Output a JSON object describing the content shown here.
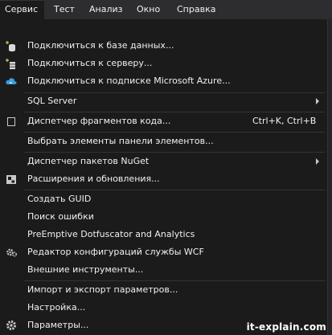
{
  "menubar": {
    "items": [
      {
        "label": "Сервис"
      },
      {
        "label": "Тест"
      },
      {
        "label": "Анализ"
      },
      {
        "label": "Окно"
      },
      {
        "label": "Справка"
      }
    ]
  },
  "menu": {
    "items": [
      {
        "label": "Подключиться к базе данных...",
        "icon": "connect-database-icon"
      },
      {
        "label": "Подключиться к серверу...",
        "icon": "connect-server-icon"
      },
      {
        "label": "Подключиться к подписке Microsoft Azure...",
        "icon": "azure-cloud-icon"
      },
      {
        "label": "SQL Server",
        "submenu": true
      },
      {
        "label": "Диспетчер фрагментов кода...",
        "shortcut": "Ctrl+K, Ctrl+B",
        "icon": "checkbox-icon"
      },
      {
        "label": "Выбрать элементы панели элементов..."
      },
      {
        "label": "Диспетчер пакетов NuGet",
        "submenu": true
      },
      {
        "label": "Расширения и обновления...",
        "icon": "extensions-icon"
      },
      {
        "label": "Создать GUID"
      },
      {
        "label": "Поиск ошибки"
      },
      {
        "label": "PreEmptive Dotfuscator and Analytics"
      },
      {
        "label": "Редактор конфигураций службы WCF",
        "icon": "wcf-gear-icon"
      },
      {
        "label": "Внешние инструменты..."
      },
      {
        "label": "Импорт и экспорт параметров..."
      },
      {
        "label": "Настройка..."
      },
      {
        "label": "Параметры...",
        "icon": "gear-icon"
      }
    ]
  },
  "watermark": "it-explain.com",
  "colors": {
    "background": "#1b1b1c",
    "menubar": "#2d2d30",
    "separator": "#333337",
    "text": "#f1f1f1",
    "highlight": "#333337"
  }
}
